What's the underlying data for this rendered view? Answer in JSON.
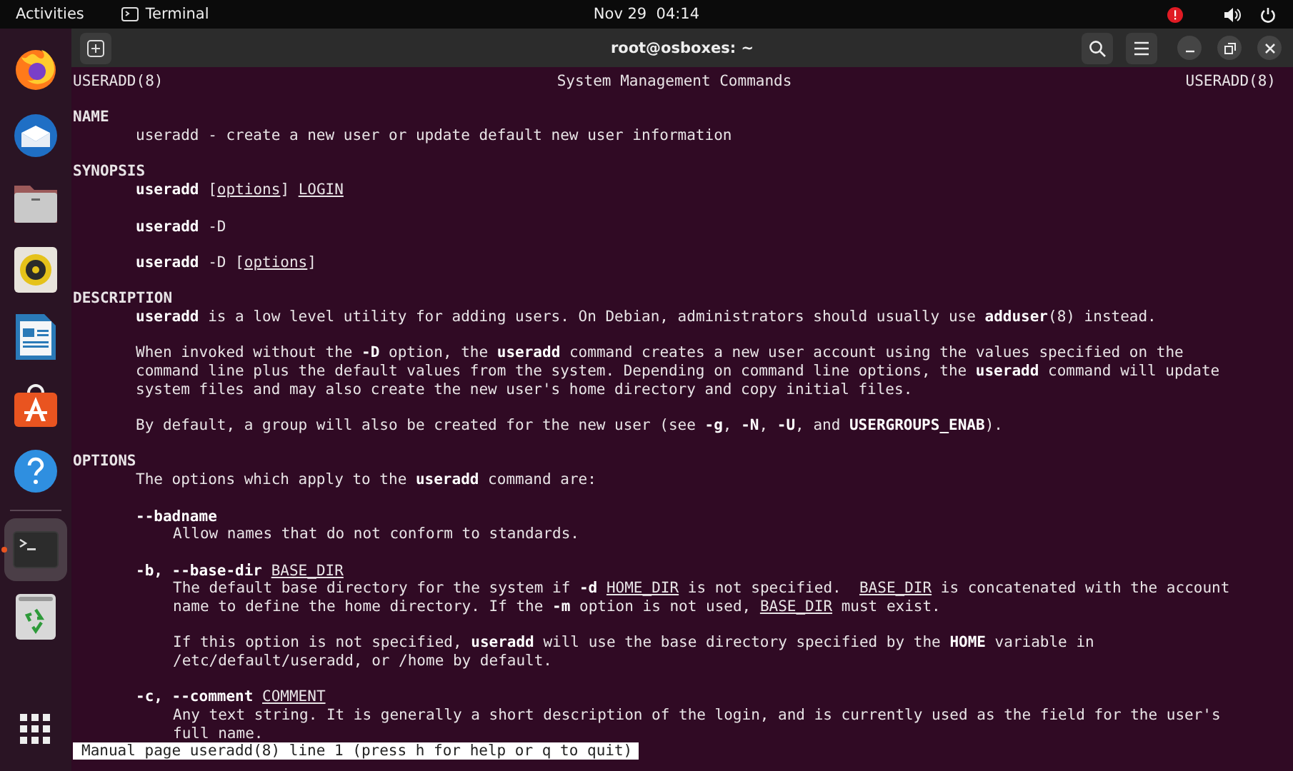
{
  "top_bar": {
    "activities": "Activities",
    "app": "Terminal",
    "clock": "Nov 29  04:14"
  },
  "dock": {
    "items": [
      {
        "kind": "browser",
        "selected": false
      },
      {
        "kind": "mail",
        "selected": false
      },
      {
        "kind": "files",
        "selected": false
      },
      {
        "kind": "music",
        "selected": false
      },
      {
        "kind": "writer",
        "selected": false
      },
      {
        "kind": "store",
        "selected": false
      },
      {
        "kind": "help",
        "selected": false
      },
      {
        "kind": "terminal",
        "selected": true
      },
      {
        "kind": "trash",
        "selected": false
      }
    ]
  },
  "window": {
    "title": "root@osboxes: ~"
  },
  "man_page": {
    "header": {
      "left": "USERADD(8)",
      "center": "System Management Commands",
      "right": "USERADD(8)"
    },
    "lines": [
      {
        "kind": "blank"
      },
      {
        "kind": "heading",
        "text": "NAME"
      },
      {
        "kind": "body",
        "text": "useradd - create a new user or update default new user information"
      },
      {
        "kind": "blank"
      },
      {
        "kind": "heading",
        "text": "SYNOPSIS"
      },
      {
        "kind": "body",
        "text": "**useradd** [*options*] *LOGIN*"
      },
      {
        "kind": "blank"
      },
      {
        "kind": "body",
        "text": "**useradd** -D"
      },
      {
        "kind": "blank"
      },
      {
        "kind": "body",
        "text": "**useradd** -D [*options*]"
      },
      {
        "kind": "blank"
      },
      {
        "kind": "heading",
        "text": "DESCRIPTION"
      },
      {
        "kind": "body",
        "text": "**useradd** is a low level utility for adding users. On Debian, administrators should usually use **adduser**(8) instead."
      },
      {
        "kind": "blank"
      },
      {
        "kind": "body",
        "text": "When invoked without the **-D** option, the **useradd** command creates a new user account using the values specified on the"
      },
      {
        "kind": "body",
        "text": "command line plus the default values from the system. Depending on command line options, the **useradd** command will update"
      },
      {
        "kind": "body",
        "text": "system files and may also create the new user's home directory and copy initial files."
      },
      {
        "kind": "blank"
      },
      {
        "kind": "body",
        "text": "By default, a group will also be created for the new user (see **-g**, **-N**, **-U**, and **USERGROUPS_ENAB**)."
      },
      {
        "kind": "blank"
      },
      {
        "kind": "heading",
        "text": "OPTIONS"
      },
      {
        "kind": "body",
        "text": "The options which apply to the **useradd** command are:"
      },
      {
        "kind": "blank"
      },
      {
        "kind": "body",
        "text": "**--badname**"
      },
      {
        "kind": "detail",
        "text": "Allow names that do not conform to standards."
      },
      {
        "kind": "blank"
      },
      {
        "kind": "body",
        "text": "**-b, --base-dir** *BASE_DIR*"
      },
      {
        "kind": "detail",
        "text": "The default base directory for the system if **-d** *HOME_DIR* is not specified.  *BASE_DIR* is concatenated with the account"
      },
      {
        "kind": "detail",
        "text": "name to define the home directory. If the **-m** option is not used, *BASE_DIR* must exist."
      },
      {
        "kind": "blank"
      },
      {
        "kind": "detail",
        "text": "If this option is not specified, **useradd** will use the base directory specified by the **HOME** variable in"
      },
      {
        "kind": "detail",
        "text": "/etc/default/useradd, or /home by default."
      },
      {
        "kind": "blank"
      },
      {
        "kind": "body",
        "text": "**-c, --comment** *COMMENT*"
      },
      {
        "kind": "detail",
        "text": "Any text string. It is generally a short description of the login, and is currently used as the field for the user's"
      },
      {
        "kind": "detail",
        "text": "full name."
      }
    ],
    "status": "Manual page useradd(8) line 1 (press h for help or q to quit)"
  }
}
